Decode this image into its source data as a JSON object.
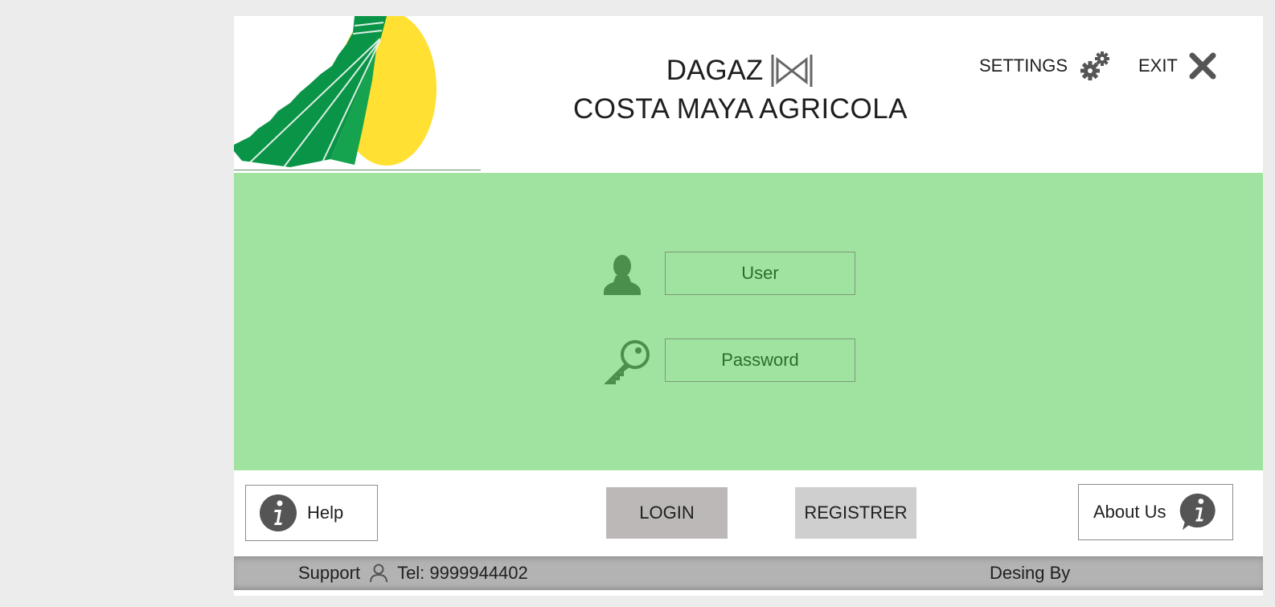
{
  "header": {
    "title_line1": "DAGAZ",
    "title_line2": "COSTA MAYA AGRICOLA",
    "settings_label": "SETTINGS",
    "exit_label": "EXIT"
  },
  "login_form": {
    "user_value": "User",
    "password_value": "Password"
  },
  "actions": {
    "help_label": "Help",
    "login_label": "LOGIN",
    "register_label": "REGISTRER",
    "about_label": "About Us"
  },
  "footer": {
    "support_label": "Support",
    "phone": "Tel: 9999944402",
    "designed_by": "Desing By"
  },
  "colors": {
    "form_background": "#a0e3a0",
    "footer_background": "#b3b3b3",
    "logo_green": "#0a9447",
    "logo_yellow": "#ffe033",
    "icon_green": "#4a8f4a",
    "icon_dark": "#555555"
  },
  "icons": {
    "settings": "gears-icon",
    "exit": "close-icon",
    "user_field": "user-silhouette-icon",
    "password_field": "key-icon",
    "help": "info-icon",
    "about": "info-speech-bubble-icon",
    "support": "person-outline-icon",
    "title_mark": "bowtie-icon"
  }
}
